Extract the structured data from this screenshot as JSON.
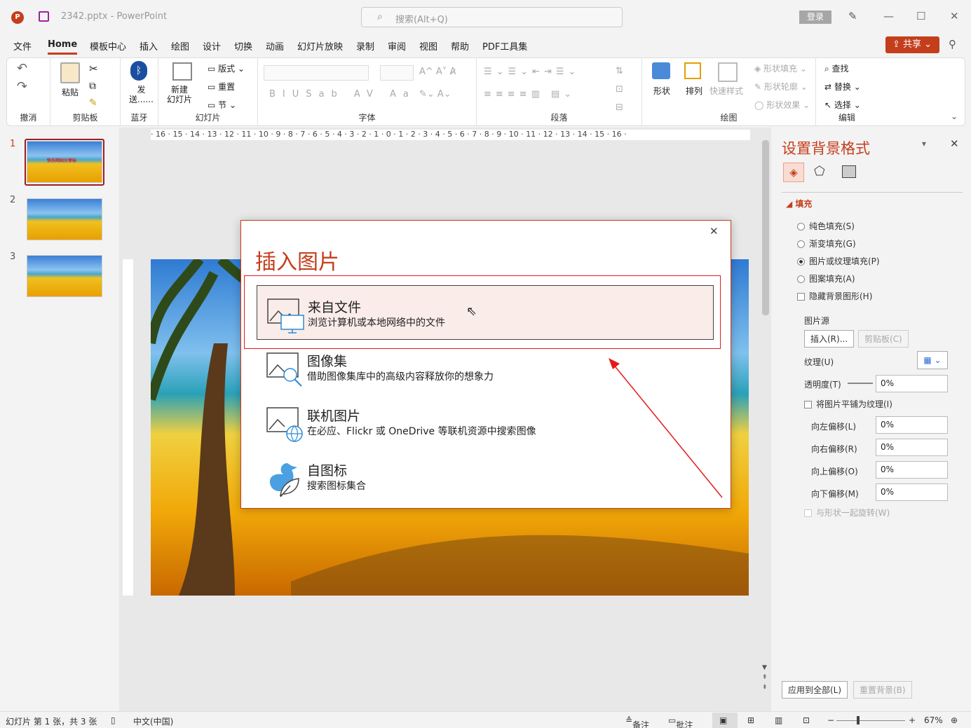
{
  "titlebar": {
    "app_badge": "P",
    "doc_title": "2342.pptx  -  PowerPoint",
    "search_placeholder": "搜索(Alt+Q)",
    "login": "登录"
  },
  "menu": {
    "items": [
      "文件",
      "Home",
      "模板中心",
      "插入",
      "绘图",
      "设计",
      "切换",
      "动画",
      "幻灯片放映",
      "录制",
      "审阅",
      "视图",
      "帮助",
      "PDF工具集"
    ],
    "active": "Home",
    "share": "共享"
  },
  "ribbon": {
    "groups": {
      "undo": "撤消",
      "clipboard": "剪贴板",
      "bluetooth": "蓝牙",
      "slides": "幻灯片",
      "font": "字体",
      "paragraph": "段落",
      "drawing": "绘图",
      "editing": "编辑"
    },
    "paste": "粘贴",
    "send": "发\n送......",
    "new_slide": "新建\n幻灯片",
    "layout": "版式",
    "reset": "重置",
    "section": "节",
    "shape": "形状",
    "arrange": "排列",
    "quick_styles": "快速样式",
    "shape_fill": "形状填充",
    "shape_outline": "形状轮廓",
    "shape_effects": "形状效果",
    "find": "查找",
    "replace": "替换",
    "select": "选择"
  },
  "slides_panel": {
    "numbers": [
      "1",
      "2",
      "3"
    ],
    "thumb1_caption": "快乐网站分享标"
  },
  "ruler": {
    "ticks": "· 16 · 15 · 14 · 13 · 12 · 11 · 10 · 9 · 8 · 7 · 6 · 5 · 4 · 3 · 2 · 1 · 0 · 1 · 2 · 3 · 4 · 5 · 6 · 7 · 8 · 9 · 10 · 11 · 12 · 13 · 14 · 15 · 16 ·"
  },
  "dialog": {
    "title": "插入图片",
    "close": "✕",
    "options": [
      {
        "title": "来自文件",
        "desc": "浏览计算机或本地网络中的文件"
      },
      {
        "title": "图像集",
        "desc": "借助图像集库中的高级内容释放你的想象力"
      },
      {
        "title": "联机图片",
        "desc": "在必应、Flickr 或 OneDrive 等联机资源中搜索图像"
      },
      {
        "title": "自图标",
        "desc": "搜索图标集合"
      }
    ]
  },
  "format_pane": {
    "title": "设置背景格式",
    "section_fill": "填充",
    "fill_options": [
      "纯色填充(S)",
      "渐变填充(G)",
      "图片或纹理填充(P)",
      "图案填充(A)"
    ],
    "selected_fill": "图片或纹理填充(P)",
    "hide_bg": "隐藏背景图形(H)",
    "picture_source": "图片源",
    "insert_btn": "插入(R)...",
    "clipboard_btn": "剪贴板(C)",
    "texture": "纹理(U)",
    "transparency": "透明度(T)",
    "transparency_value": "0%",
    "tile": "将图片平铺为纹理(I)",
    "offsets": [
      {
        "label": "向左偏移(L)",
        "value": "0%"
      },
      {
        "label": "向右偏移(R)",
        "value": "0%"
      },
      {
        "label": "向上偏移(O)",
        "value": "0%"
      },
      {
        "label": "向下偏移(M)",
        "value": "0%"
      }
    ],
    "rotate_with_shape": "与形状一起旋转(W)",
    "apply_all": "应用到全部(L)",
    "reset_bg": "重置背景(B)"
  },
  "status": {
    "slide_info": "幻灯片 第 1 张，共 3 张",
    "language": "中文(中国)",
    "notes": "备注",
    "comments": "批注",
    "zoom": "67%"
  },
  "colors": {
    "accent": "#c43e1c",
    "selection_red": "#e21b1b"
  }
}
